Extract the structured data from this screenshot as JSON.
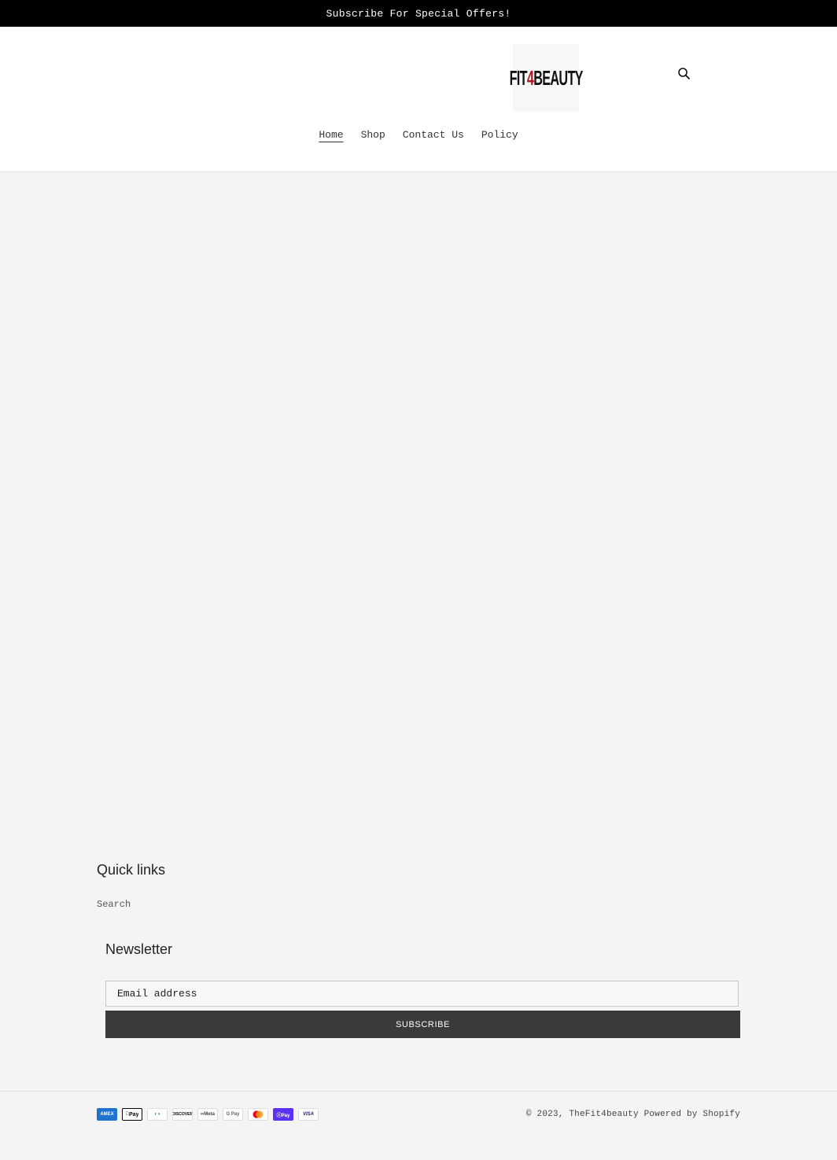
{
  "announcement": "Subscribe For Special Offers!",
  "logo": {
    "text_fit": "FIT",
    "text_4": "4",
    "text_beauty": "BEAUTY"
  },
  "header": {
    "search_icon": "search-icon"
  },
  "nav": [
    {
      "label": "Home",
      "active": true
    },
    {
      "label": "Shop"
    },
    {
      "label": "Contact Us"
    },
    {
      "label": "Policy"
    }
  ],
  "footer": {
    "quick_links_title": "Quick links",
    "quick_links": [
      "Search"
    ],
    "newsletter_title": "Newsletter",
    "email_placeholder": "Email address",
    "subscribe_label": "SUBSCRIBE",
    "payment_icons": [
      "American Express",
      "Apple Pay",
      "Diners Club",
      "Discover",
      "Meta Pay",
      "Google Pay",
      "Mastercard",
      "Shop Pay",
      "Visa"
    ],
    "payment_labels": {
      "amex": "AMEX",
      "apple": "Pay",
      "diners": "◐◑",
      "discover": "DISCOVER",
      "meta": "∞Meta",
      "gpay": "G Pay",
      "shoppay": "ⓢPay",
      "visa": "VISA"
    },
    "copyright_prefix": "© 2023,",
    "store_name": "TheFit4beauty",
    "powered": "Powered by Shopify"
  },
  "colors": {
    "announcement_bg": "#000000",
    "button_bg": "#3a3a3a",
    "page_bg": "#f4f4f4",
    "logo_accent": "#b0171f"
  }
}
